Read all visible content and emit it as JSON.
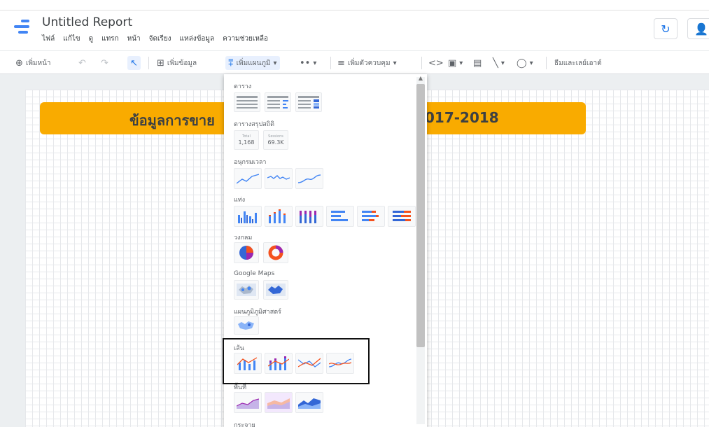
{
  "header": {
    "title": "Untitled Report",
    "menu": [
      "ไฟล์",
      "แก้ไข",
      "ดู",
      "แทรก",
      "หน้า",
      "จัดเรียง",
      "แหล่งข้อมูล",
      "ความช่วยเหลือ"
    ],
    "refresh_icon": "refresh-icon",
    "share_icon": "share-person-icon"
  },
  "toolbar": {
    "add_page": "เพิ่มหน้า",
    "add_data": "เพิ่มข้อมูล",
    "add_chart": "เพิ่มแผนภูมิ",
    "add_control": "เพิ่มตัวควบคุม",
    "theme_layout": "ธีมและเลย์เอาต์"
  },
  "banner": {
    "left_text": "ข้อมูลการขาย",
    "right_text": "017-2018",
    "color": "#f9ab00"
  },
  "chart_menu": {
    "sections": {
      "table": "ตาราง",
      "scorecard": "ตารางสรุปสถิติ",
      "timeseries": "อนุกรมเวลา",
      "bar": "แท่ง",
      "pie": "วงกลม",
      "google_maps": "Google Maps",
      "geo": "แผนภูมิภูมิศาสตร์",
      "line": "เส้น",
      "area": "พื้นที่",
      "scatter": "กระจาย"
    },
    "scorecards": [
      {
        "label": "Total",
        "value": "1,168"
      },
      {
        "label": "Sessions",
        "value": "69.3K"
      }
    ],
    "colors": {
      "blue": "#4285f4",
      "dark_blue": "#3367d6",
      "orange": "#f4511e",
      "purple": "#9c27b0",
      "green": "#34a853"
    }
  }
}
